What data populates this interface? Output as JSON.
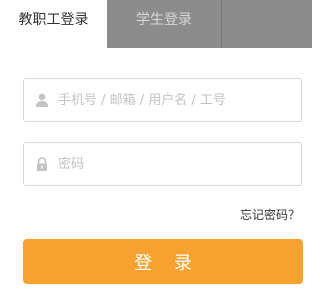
{
  "tabs": [
    {
      "label": "教职工登录",
      "active": true
    },
    {
      "label": "学生登录",
      "active": false
    }
  ],
  "account": {
    "placeholder": "手机号 / 邮箱 / 用户名 / 工号",
    "icon": "user-icon"
  },
  "password": {
    "placeholder": "密码",
    "icon": "lock-icon"
  },
  "forgot_password": "忘记密码？",
  "login_button": "登 录",
  "colors": {
    "accent": "#f7a130",
    "inactive_tab": "#8c8c8c",
    "border": "#d6d6d6",
    "placeholder": "#c3c3c3"
  }
}
